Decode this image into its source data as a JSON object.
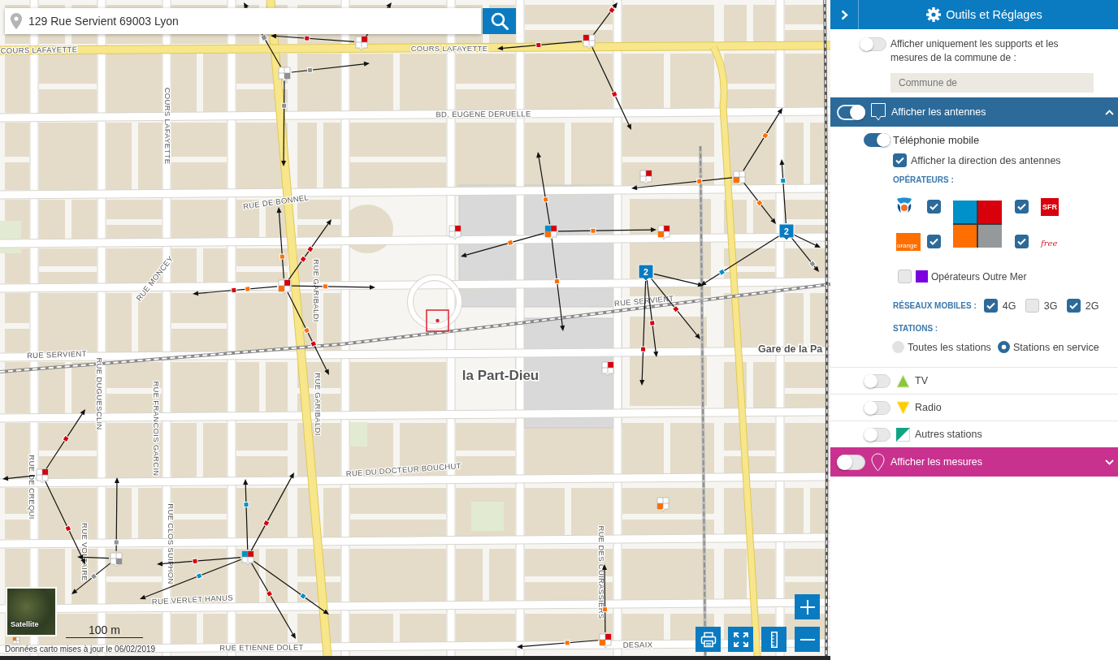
{
  "search": {
    "value": "129 Rue Servient 69003 Lyon"
  },
  "map": {
    "street_labels": [
      "COURS LAFAYETTE",
      "COURS LAFAYETTE",
      "COURS LAFAYETTE",
      "BD. EUGENE DERUELLE",
      "RUE DE BONNEL",
      "RUE MONCEY",
      "RUE GARIBALDI",
      "RUE SERVIENT",
      "RUE SERVIENT",
      "RUE DUGUESCLIN",
      "RUE FRANCOIS GARCIN",
      "RUE GARIBALDI",
      "RUE DU DOCTEUR BOUCHUT",
      "RUE DE CREQUI",
      "RUE VOLTAIRE",
      "RUE CLOS SUIPHON",
      "RUE DES CUIRASSIERS",
      "RUE VERLET HANUS",
      "RUE ETIENNE DOLET",
      "DESAIX"
    ],
    "place_labels": [
      "la Part-Dieu",
      "Gare de la Pa"
    ],
    "cluster_counts": [
      "2",
      "2"
    ]
  },
  "map_controls": {
    "layer_button": "Satellite",
    "scale": "100 m",
    "attribution": "Données carto mises à jour le 06/02/2019"
  },
  "panel": {
    "title": "Outils et Réglages",
    "commune_filter": {
      "on": false,
      "label": "Afficher uniquement les supports et les mesures de la commune de :",
      "placeholder": "Commune de"
    },
    "sections": [
      {
        "kind": "antennas",
        "title": "Afficher les antennes",
        "on": true,
        "expanded": true,
        "content": {
          "mobile": {
            "label": "Téléphonie mobile",
            "on": true
          },
          "direction": {
            "label": "Afficher la direction des antennes",
            "checked": true
          },
          "operators_heading": "OPÉRATEURS :",
          "operators": [
            {
              "kind": "swirl-logo",
              "checked": true,
              "color": "#0091c8"
            },
            {
              "kind": "block-logo",
              "logo_text": "SFR",
              "checked": true,
              "color": "#d9000d"
            },
            {
              "kind": "corner-logo",
              "logo_text": "orange",
              "checked": true,
              "color": "#ff6e00"
            },
            {
              "kind": "script-logo",
              "logo_text": "free",
              "checked": true,
              "color": "#96999b"
            },
            {
              "kind": "labelled",
              "label": "Opérateurs Outre Mer",
              "checked": false,
              "color": "#7b00e0"
            }
          ],
          "networks_heading": "RÉSEAUX MOBILES :",
          "networks": [
            {
              "label": "4G",
              "checked": true
            },
            {
              "label": "3G",
              "checked": false
            },
            {
              "label": "2G",
              "checked": true
            }
          ],
          "stations_heading": "STATIONS :",
          "stations": [
            {
              "label": "Toutes les stations",
              "selected": false
            },
            {
              "label": "Stations en service",
              "selected": true
            }
          ],
          "layers": [
            {
              "kind": "tv",
              "label": "TV",
              "on": false
            },
            {
              "kind": "radio",
              "label": "Radio",
              "on": false
            },
            {
              "kind": "other",
              "label": "Autres stations",
              "on": false
            }
          ]
        }
      },
      {
        "kind": "measures",
        "title": "Afficher les mesures",
        "on": false,
        "expanded": false
      }
    ]
  }
}
